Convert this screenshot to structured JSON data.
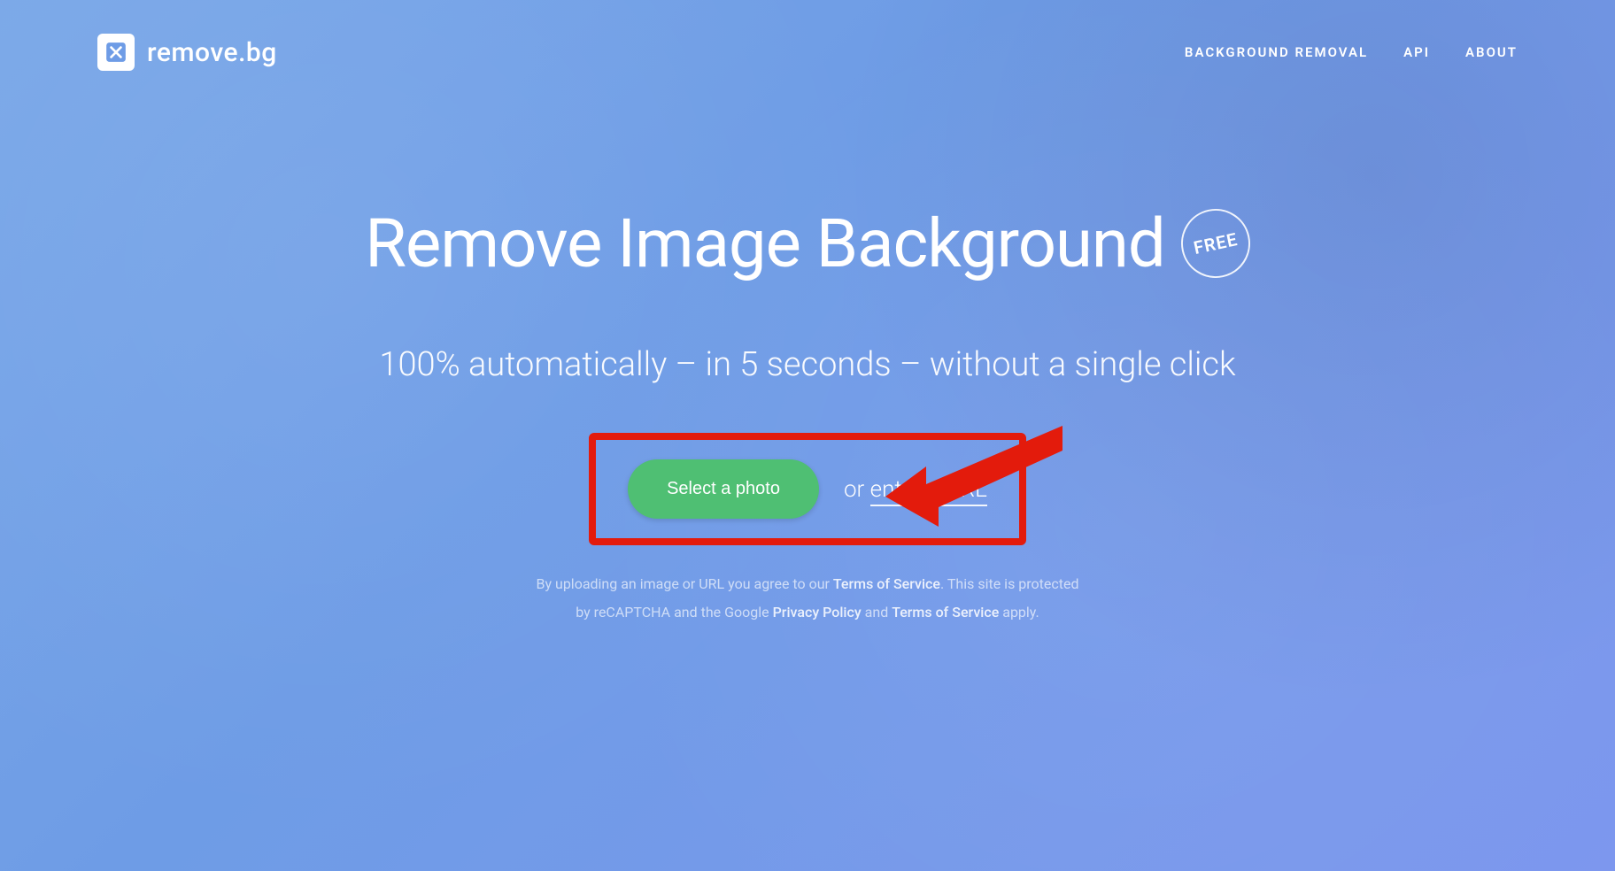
{
  "brand": {
    "name": "remove.bg"
  },
  "nav": {
    "items": [
      {
        "label": "BACKGROUND REMOVAL"
      },
      {
        "label": "API"
      },
      {
        "label": "ABOUT"
      }
    ]
  },
  "hero": {
    "title": "Remove Image Background",
    "badge": "FREE",
    "subtitle": "100% automatically – in 5 seconds – without a single click"
  },
  "actions": {
    "select_label": "Select a photo",
    "or_label": "or ",
    "url_label": "enter a URL"
  },
  "legal": {
    "line1_a": "By uploading an image or URL you agree to our ",
    "tos1": "Terms of Service",
    "line1_b": ". This site is protected",
    "line2_a": "by reCAPTCHA and the Google ",
    "privacy": "Privacy Policy",
    "line2_b": " and ",
    "tos2": "Terms of Service",
    "line2_c": " apply."
  },
  "annotation": {
    "highlight_color": "#e31b0c"
  }
}
